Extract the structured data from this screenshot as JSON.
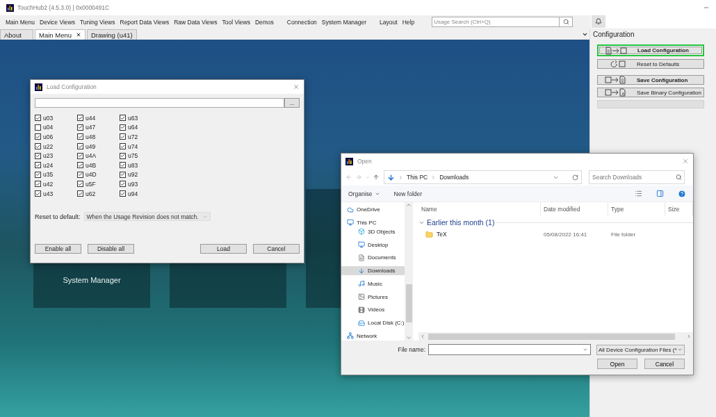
{
  "window": {
    "title": "TouchHub2 (4.5.3.0) | 0x0000491C"
  },
  "menu": [
    {
      "group": [
        {
          "label": "Main Menu"
        },
        {
          "label": "Device Views"
        },
        {
          "label": "Tuning Views"
        },
        {
          "label": "Report Data Views"
        },
        {
          "label": "Raw Data Views"
        },
        {
          "label": "Tool Views"
        },
        {
          "label": "Demos"
        }
      ]
    },
    {
      "group": [
        {
          "label": "Connection"
        },
        {
          "label": "System Manager"
        }
      ]
    },
    {
      "group": [
        {
          "label": "Layout"
        },
        {
          "label": "Help"
        }
      ]
    }
  ],
  "search": {
    "placeholder": "Usage Search (Ctrl+Q)"
  },
  "tabs": [
    {
      "label": "About",
      "selected": false,
      "closable": false
    },
    {
      "label": "Main Menu",
      "selected": true,
      "closable": true
    },
    {
      "label": "Drawing (u41)",
      "selected": false,
      "closable": false
    }
  ],
  "tiles": [
    {
      "label": "System Manager"
    }
  ],
  "side_panel": {
    "title": "Configuration",
    "buttons": [
      {
        "kind": "load",
        "label": "Load Configuration",
        "bold": true,
        "focused": true
      },
      {
        "kind": "reset",
        "label": "Reset to Defaults",
        "bold": false,
        "focused": false
      },
      {
        "kind": "save",
        "label": "Save Configuration",
        "bold": true,
        "focused": false
      },
      {
        "kind": "save-binary",
        "label": "Save Binary Configuration",
        "bold": false,
        "focused": false
      }
    ]
  },
  "load_dialog": {
    "title": "Load Configuration",
    "path_button": "...",
    "usages": [
      {
        "label": "u03",
        "checked": true
      },
      {
        "label": "u04",
        "checked": false
      },
      {
        "label": "u06",
        "checked": true
      },
      {
        "label": "u22",
        "checked": true
      },
      {
        "label": "u23",
        "checked": true
      },
      {
        "label": "u24",
        "checked": true
      },
      {
        "label": "u35",
        "checked": true
      },
      {
        "label": "u42",
        "checked": true
      },
      {
        "label": "u43",
        "checked": true
      },
      {
        "label": "u44",
        "checked": true
      },
      {
        "label": "u47",
        "checked": true
      },
      {
        "label": "u48",
        "checked": true
      },
      {
        "label": "u49",
        "checked": true
      },
      {
        "label": "u4A",
        "checked": true
      },
      {
        "label": "u4B",
        "checked": true
      },
      {
        "label": "u4D",
        "checked": true
      },
      {
        "label": "u5F",
        "checked": true
      },
      {
        "label": "u62",
        "checked": true
      },
      {
        "label": "u63",
        "checked": true
      },
      {
        "label": "u64",
        "checked": true
      },
      {
        "label": "u72",
        "checked": true
      },
      {
        "label": "u74",
        "checked": true
      },
      {
        "label": "u75",
        "checked": true
      },
      {
        "label": "u83",
        "checked": true
      },
      {
        "label": "u92",
        "checked": true
      },
      {
        "label": "u93",
        "checked": true
      },
      {
        "label": "u94",
        "checked": true
      }
    ],
    "reset_label": "Reset to default:",
    "reset_value": "When the Usage Revision does not match.",
    "left_buttons": [
      "Enable all",
      "Disable all"
    ],
    "right_buttons": [
      "Load",
      "Cancel"
    ]
  },
  "open_dialog": {
    "title": "Open",
    "breadcrumb": [
      "This PC",
      "Downloads"
    ],
    "search_placeholder": "Search Downloads",
    "toolbar": [
      "Organise",
      "New folder"
    ],
    "sidebar": [
      {
        "kind": "cloud",
        "label": "OneDrive",
        "selected": false
      },
      {
        "kind": "pc",
        "label": "This PC",
        "selected": false,
        "children": [
          {
            "kind": "objects",
            "label": "3D Objects",
            "selected": false
          },
          {
            "kind": "desktop",
            "label": "Desktop",
            "selected": false
          },
          {
            "kind": "documents",
            "label": "Documents",
            "selected": false
          },
          {
            "kind": "downloads",
            "label": "Downloads",
            "selected": true
          },
          {
            "kind": "music",
            "label": "Music",
            "selected": false
          },
          {
            "kind": "pictures",
            "label": "Pictures",
            "selected": false
          },
          {
            "kind": "videos",
            "label": "Videos",
            "selected": false
          },
          {
            "kind": "disk",
            "label": "Local Disk (C:)",
            "selected": false
          }
        ]
      },
      {
        "kind": "network",
        "label": "Network",
        "selected": false
      }
    ],
    "columns": [
      "Name",
      "Date modified",
      "Type",
      "Size"
    ],
    "group": "Earlier this month (1)",
    "rows": [
      {
        "name": "TeX",
        "date": "05/08/2022 16:41",
        "type": "File folder"
      }
    ],
    "file_name_label": "File name:",
    "filter": "All Device Configuration Files (*",
    "buttons": [
      "Open",
      "Cancel"
    ]
  }
}
